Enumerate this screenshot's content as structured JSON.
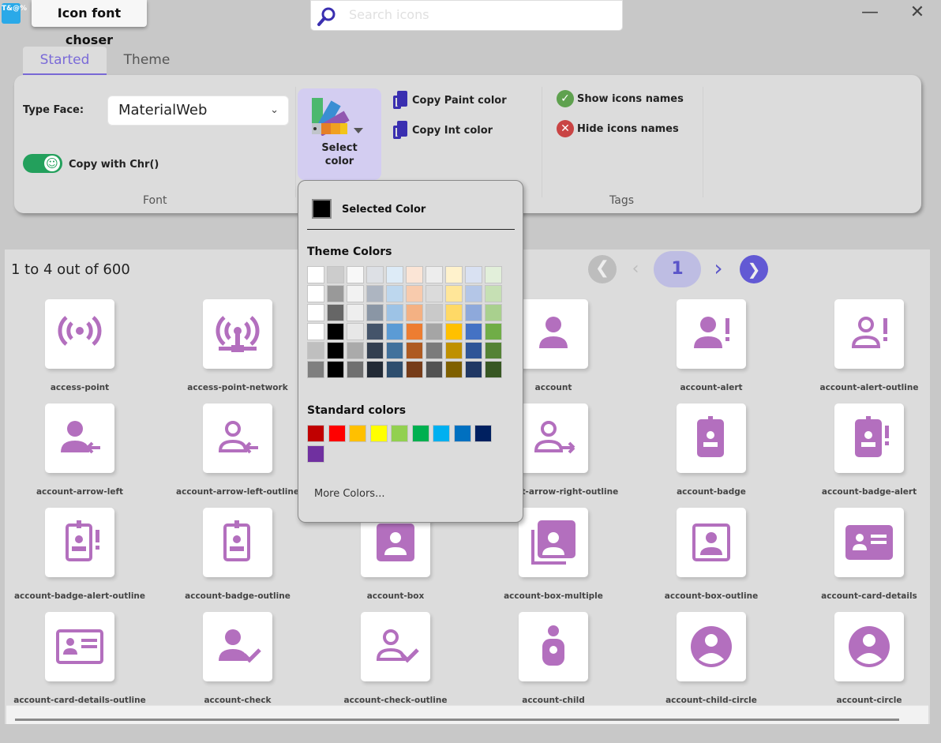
{
  "app": {
    "icon_text": "T&@%",
    "title": "Icon font choser",
    "search_placeholder": "Search icons",
    "minimize": "—",
    "close": "✕"
  },
  "tabs": [
    {
      "label": "Started",
      "active": true
    },
    {
      "label": "Theme",
      "active": false
    }
  ],
  "ribbon": {
    "font_group": {
      "typeface_label": "Type Face:",
      "typeface_value": "MaterialWeb",
      "copy_with_chr_label": "Copy with Chr()",
      "copy_with_chr_on": true,
      "group_label": "Font"
    },
    "color_group": {
      "select_color_line1": "Select",
      "select_color_line2": "color",
      "copy_paint": "Copy Paint color",
      "copy_int": "Copy Int color"
    },
    "tags_group": {
      "show_names": "Show icons names",
      "hide_names": "Hide icons names",
      "group_label": "Tags"
    }
  },
  "color_popup": {
    "selected_label": "Selected Color",
    "selected_color": "#000000",
    "theme_title": "Theme Colors",
    "theme_colors": [
      [
        "#FFFFFF",
        "#CCCCCC",
        "#F8F8F8",
        "#DDE0E5",
        "#DDEBF7",
        "#FBE5D6",
        "#EDEDED",
        "#FFF2CC",
        "#D9E1F2",
        "#E2EFDA"
      ],
      [
        "#FFFFFF",
        "#999999",
        "#F2F2F2",
        "#ADB5C1",
        "#BDD7EE",
        "#F8CBAD",
        "#DBDBDB",
        "#FFE699",
        "#B4C6E7",
        "#C6E0B4"
      ],
      [
        "#FFFFFF",
        "#666666",
        "#EEEEEE",
        "#8A96A5",
        "#9DC3E6",
        "#F4B183",
        "#C9C9C9",
        "#FFD966",
        "#8EA9DB",
        "#A9D08E"
      ],
      [
        "#FFFFFF",
        "#000000",
        "#E7E7E7",
        "#44546A",
        "#5B9BD5",
        "#ED7D31",
        "#A5A5A5",
        "#FFC000",
        "#4472C4",
        "#70AD47"
      ],
      [
        "#BFBFBF",
        "#000000",
        "#AAAAAA",
        "#333F50",
        "#41719C",
        "#AE5A21",
        "#7B7B7B",
        "#BF9000",
        "#2F5597",
        "#548235"
      ],
      [
        "#7F7F7F",
        "#000000",
        "#707070",
        "#222A35",
        "#2E4E6E",
        "#763C19",
        "#525252",
        "#7F6000",
        "#203864",
        "#385723"
      ]
    ],
    "standard_title": "Standard colors",
    "standard_colors": [
      "#C00000",
      "#FF0000",
      "#FFC000",
      "#FFFF00",
      "#92D050",
      "#00B050",
      "#00B0F0",
      "#0070C0",
      "#002060",
      "#7030A0"
    ],
    "more_colors": "More Colors..."
  },
  "results": {
    "count_text": "1 to 4 out of 600",
    "current_page": "1",
    "icon_color": "#B36FBE",
    "icons": [
      {
        "name": "access-point",
        "glyph": "access-point"
      },
      {
        "name": "access-point-network",
        "glyph": "access-point-network"
      },
      {
        "name": "",
        "glyph": "account"
      },
      {
        "name": "account",
        "glyph": "account"
      },
      {
        "name": "account-alert",
        "glyph": "account-alert"
      },
      {
        "name": "account-alert-outline",
        "glyph": "account-alert-outline"
      },
      {
        "name": "account-arrow-left",
        "glyph": "account-arrow-left"
      },
      {
        "name": "account-arrow-left-outline",
        "glyph": "account-arrow-left-outline"
      },
      {
        "name": "",
        "glyph": "account"
      },
      {
        "name": "account-arrow-right-outline",
        "glyph": "account-arrow-right-outline"
      },
      {
        "name": "account-badge",
        "glyph": "account-badge"
      },
      {
        "name": "account-badge-alert",
        "glyph": "account-badge-alert"
      },
      {
        "name": "account-badge-alert-outline",
        "glyph": "account-badge-alert-outline"
      },
      {
        "name": "account-badge-outline",
        "glyph": "account-badge-outline"
      },
      {
        "name": "account-box",
        "glyph": "account-box"
      },
      {
        "name": "account-box-multiple",
        "glyph": "account-box-multiple"
      },
      {
        "name": "account-box-outline",
        "glyph": "account-box-outline"
      },
      {
        "name": "account-card-details",
        "glyph": "account-card-details"
      },
      {
        "name": "account-card-details-outline",
        "glyph": "account-card-details-outline"
      },
      {
        "name": "account-check",
        "glyph": "account-check"
      },
      {
        "name": "account-check-outline",
        "glyph": "account-check-outline"
      },
      {
        "name": "account-child",
        "glyph": "account-child"
      },
      {
        "name": "account-child-circle",
        "glyph": "account-child-circle"
      },
      {
        "name": "account-circle",
        "glyph": "account-circle"
      }
    ]
  }
}
